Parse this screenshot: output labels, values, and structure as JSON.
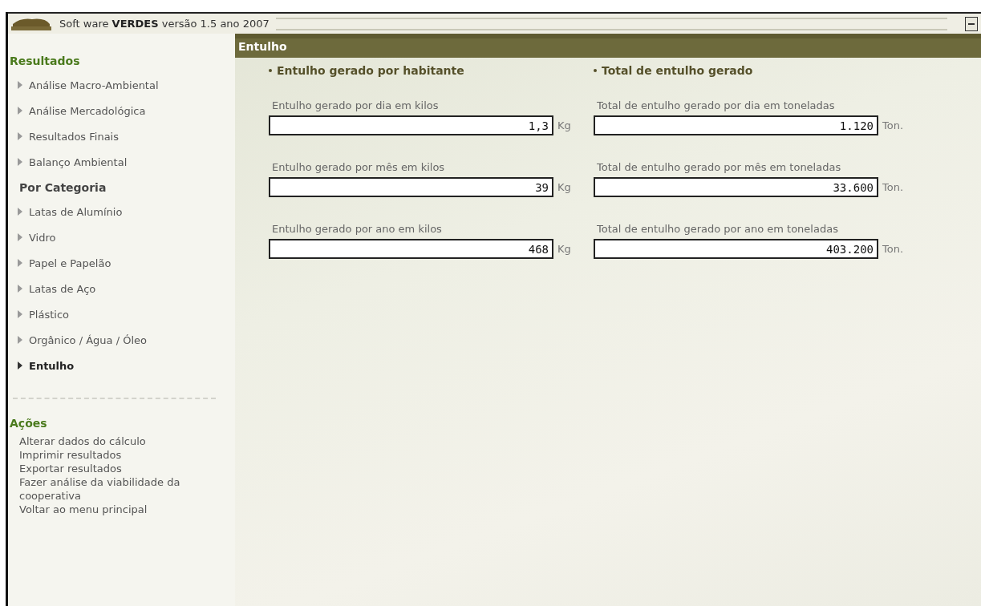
{
  "window": {
    "title": "Soft ware **VERDES** versão 1.5 ano 2007"
  },
  "sidebar": {
    "sections": [
      {
        "title": "Resultados",
        "items": [
          {
            "label": "Análise Macro-Ambiental",
            "selected": false
          },
          {
            "label": "Análise Mercadológica",
            "selected": false
          },
          {
            "label": "Resultados Finais",
            "selected": false
          },
          {
            "label": "Balanço Ambiental",
            "selected": false
          }
        ]
      },
      {
        "title": "Por Categoria",
        "items": [
          {
            "label": "Latas de Alumínio",
            "selected": false
          },
          {
            "label": "Vidro",
            "selected": false
          },
          {
            "label": "Papel e Papelão",
            "selected": false
          },
          {
            "label": "Latas de Aço",
            "selected": false
          },
          {
            "label": "Plástico",
            "selected": false
          },
          {
            "label": "Orgânico / Água / Óleo",
            "selected": false
          },
          {
            "label": "Entulho",
            "selected": true
          }
        ]
      }
    ],
    "actions": {
      "title": "Ações",
      "links": [
        "Alterar dados do cálculo",
        "Imprimir resultados",
        "Exportar resultados",
        "Fazer análise da viabilidade da cooperativa",
        "Voltar ao menu principal"
      ]
    }
  },
  "panel": {
    "title": "Entulho",
    "columns": [
      {
        "heading": "Entulho gerado por habitante",
        "fields": [
          {
            "label": "Entulho gerado por dia em kilos",
            "value": "1,3",
            "unit": "Kg"
          },
          {
            "label": "Entulho gerado por mês em kilos",
            "value": "39",
            "unit": "Kg"
          },
          {
            "label": "Entulho gerado por ano em kilos",
            "value": "468",
            "unit": "Kg"
          }
        ]
      },
      {
        "heading": "Total de entulho gerado",
        "fields": [
          {
            "label": "Total de entulho gerado por dia em toneladas",
            "value": "1.120",
            "unit": "Ton."
          },
          {
            "label": "Total de entulho gerado por mês em toneladas",
            "value": "33.600",
            "unit": "Ton."
          },
          {
            "label": "Total de entulho gerado por ano em toneladas",
            "value": "403.200",
            "unit": "Ton."
          }
        ]
      }
    ]
  }
}
